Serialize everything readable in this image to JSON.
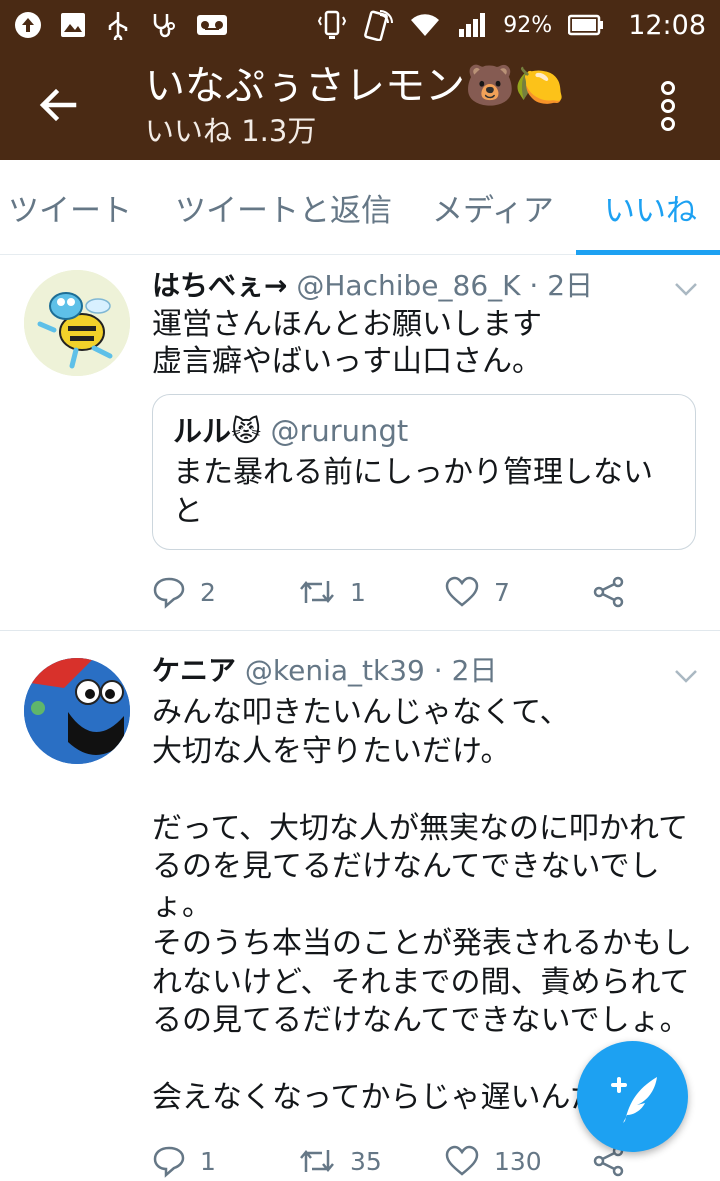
{
  "status_bar": {
    "battery": "92%",
    "time": "12:08",
    "icons": [
      "upload-icon",
      "image-icon",
      "usb-icon",
      "stethoscope-icon",
      "voicemail-icon",
      "vibrate-icon",
      "nfc-icon",
      "wifi-icon",
      "signal-icon",
      "battery-icon"
    ]
  },
  "app_bar": {
    "title": "いなぷぅさレモン🐻🍋",
    "subtitle": "いいね 1.3万",
    "back_icon": "arrow-back-icon",
    "more_icon": "more-vert-icon"
  },
  "tabs": [
    {
      "label": "ツイート",
      "active": false
    },
    {
      "label": "ツイートと返信",
      "active": false
    },
    {
      "label": "メディア",
      "active": false
    },
    {
      "label": "いいね",
      "active": true
    }
  ],
  "tweets": [
    {
      "name": "はちべぇ→",
      "handle": "@Hachibe_86_K",
      "time": "· 2日",
      "text": "運営さんほんとお願いします\n虚言癖やばいっす山口さん。",
      "quote": {
        "name": "ルル😾",
        "handle": "@rurungt",
        "text": "また暴れる前にしっかり管理しないと"
      },
      "replies": "2",
      "retweets": "1",
      "likes": "7"
    },
    {
      "name": "ケニア",
      "handle": "@kenia_tk39",
      "time": "· 2日",
      "text": "みんな叩きたいんじゃなくて、\n大切な人を守りたいだけ。\n\nだって、大切な人が無実なのに叩かれてるのを見てるだけなんてできないでしょ。\nそのうち本当のことが発表されるかもしれないけど、それまでの間、責められてるの見てるだけなんてできないでしょ。\n\n会えなくなってからじゃ遅いんだ",
      "replies": "1",
      "retweets": "35",
      "likes": "130"
    }
  ],
  "colors": {
    "header": "#4a2a14",
    "accent": "#1da1f2",
    "muted": "#657786"
  },
  "fab_icon": "compose-tweet-icon"
}
